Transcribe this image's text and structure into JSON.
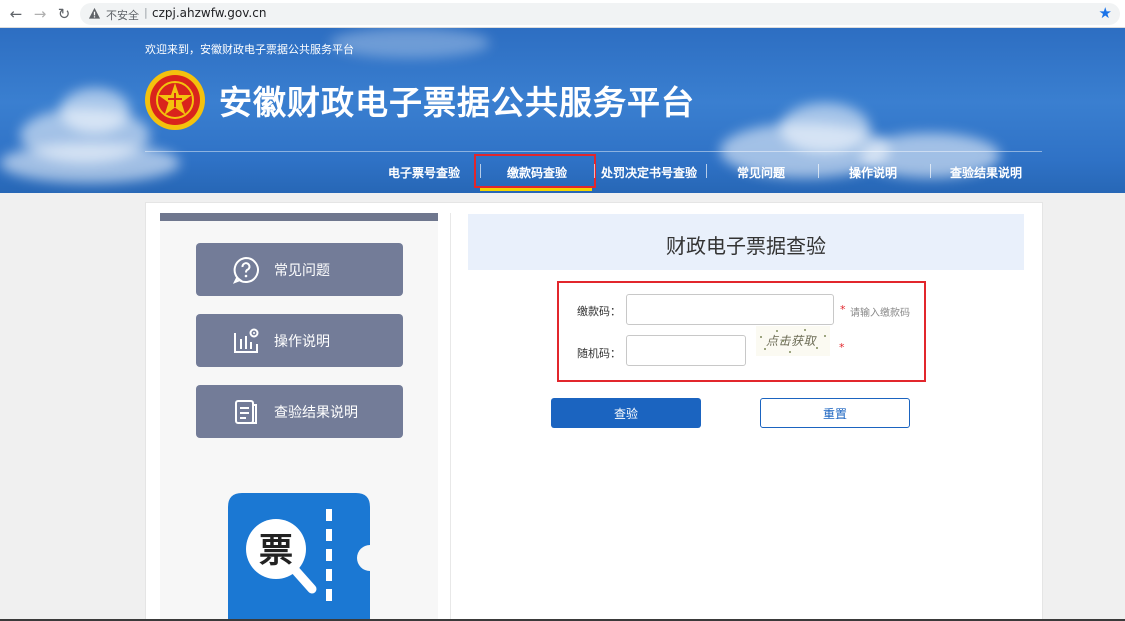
{
  "browser": {
    "security_label": "不安全",
    "url": "czpj.ahzwfw.gov.cn"
  },
  "header": {
    "welcome": "欢迎来到，安徽财政电子票据公共服务平台",
    "title": "安徽财政电子票据公共服务平台"
  },
  "nav": {
    "items": [
      {
        "label": "电子票号查验"
      },
      {
        "label": "缴款码查验",
        "active": true
      },
      {
        "label": "处罚决定书号查验"
      },
      {
        "label": "常见问题"
      },
      {
        "label": "操作说明"
      },
      {
        "label": "查验结果说明"
      }
    ]
  },
  "sidebar": {
    "buttons": [
      {
        "label": "常见问题",
        "icon": "question-icon"
      },
      {
        "label": "操作说明",
        "icon": "manual-icon"
      },
      {
        "label": "查验结果说明",
        "icon": "document-icon"
      }
    ],
    "ticket_glyph": "票"
  },
  "form": {
    "title": "财政电子票据查验",
    "payment_code": {
      "label": "缴款码：",
      "value": "",
      "required_mark": "*",
      "hint": "请输入缴款码"
    },
    "random_code": {
      "label": "随机码：",
      "value": "",
      "required_mark": "*",
      "captcha_text": "点击获取"
    },
    "submit_label": "查验",
    "reset_label": "重置"
  },
  "colors": {
    "header_blue": "#2d6ec2",
    "primary_blue": "#1b64c0",
    "highlight_red": "#e2262c",
    "sidebar_button": "#737c98",
    "nav_underline": "#f2d400"
  }
}
